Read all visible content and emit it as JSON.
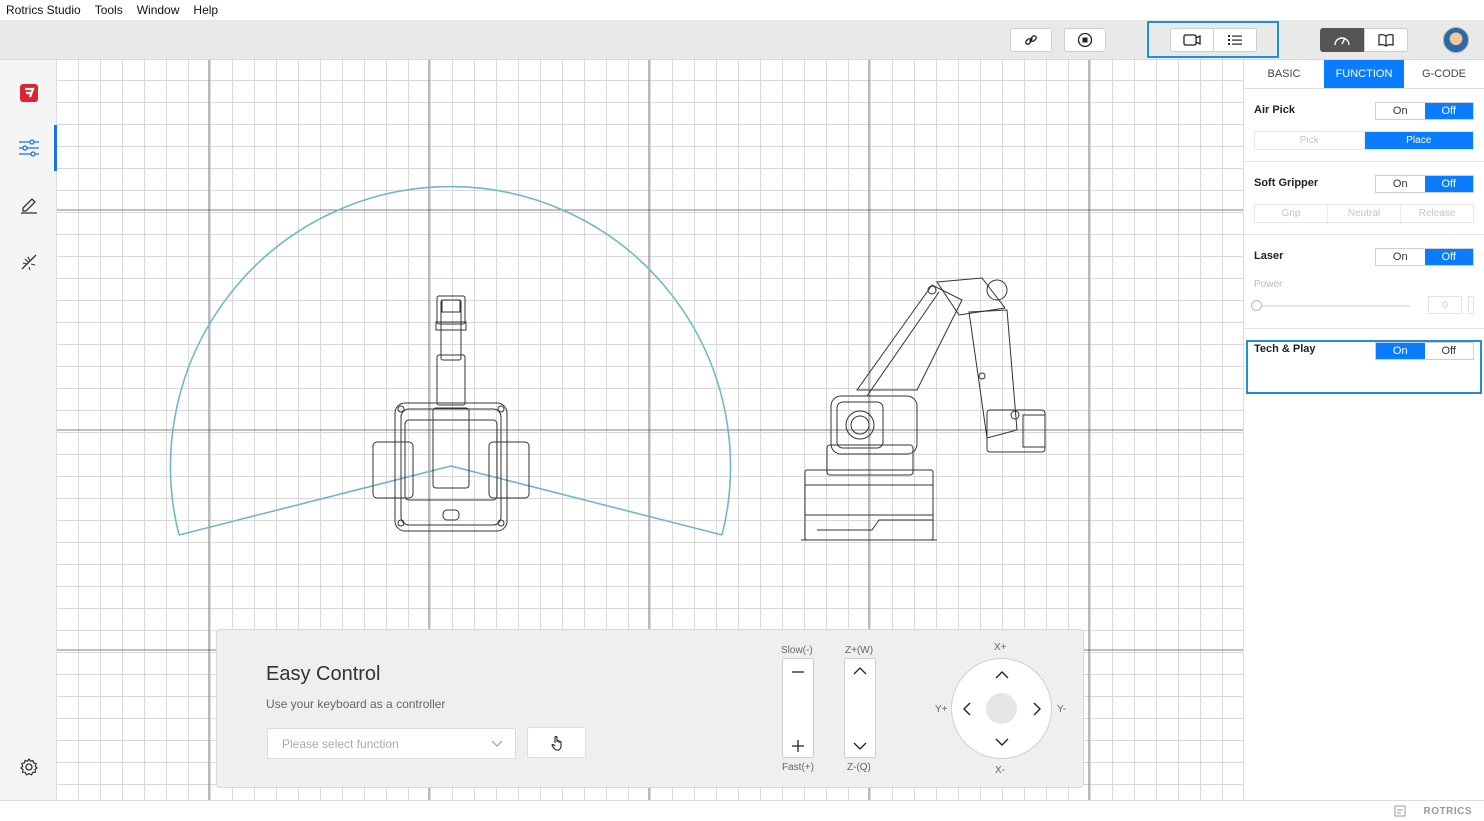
{
  "menubar": {
    "items": [
      "Rotrics Studio",
      "Tools",
      "Window",
      "Help"
    ]
  },
  "toolbar": {
    "buttons": [
      "link-icon",
      "record-icon",
      "camera-icon",
      "list-icon",
      "speed-icon",
      "book-icon"
    ]
  },
  "sidebar": {
    "items": [
      "logo-icon",
      "sliders-icon",
      "pencil-icon",
      "laser-icon"
    ],
    "settings": "gear-icon"
  },
  "panel": {
    "tabs": [
      "BASIC",
      "FUNCTION",
      "G-CODE"
    ],
    "active_tab": "FUNCTION",
    "air_pick": {
      "title": "Air Pick",
      "on": "On",
      "off": "Off",
      "state": "Off",
      "modes": [
        "Pick",
        "Place"
      ],
      "mode": "Place"
    },
    "soft_gripper": {
      "title": "Soft Gripper",
      "on": "On",
      "off": "Off",
      "state": "Off",
      "modes": [
        "Grip",
        "Neutral",
        "Release"
      ]
    },
    "laser": {
      "title": "Laser",
      "on": "On",
      "off": "Off",
      "state": "Off",
      "power_label": "Power",
      "power_value": "0",
      "power_level": 0
    },
    "teach_play": {
      "title": "Tech & Play",
      "on": "On",
      "off": "Off",
      "state": "On"
    }
  },
  "easy_control": {
    "title": "Easy Control",
    "subtitle": "Use your keyboard as a controller",
    "select_placeholder": "Please select function",
    "speed_top": "Slow(-)",
    "speed_bottom": "Fast(+)",
    "z_top": "Z+(W)",
    "z_bottom": "Z-(Q)",
    "x_plus": "X+",
    "x_minus": "X-",
    "y_plus": "Y+",
    "y_minus": "Y-"
  },
  "statusbar": {
    "brand": "ROTRICS"
  },
  "colors": {
    "accent": "#0a7cff",
    "workspace_arc": "#6fb8c9",
    "outline": "#1e90d6"
  }
}
